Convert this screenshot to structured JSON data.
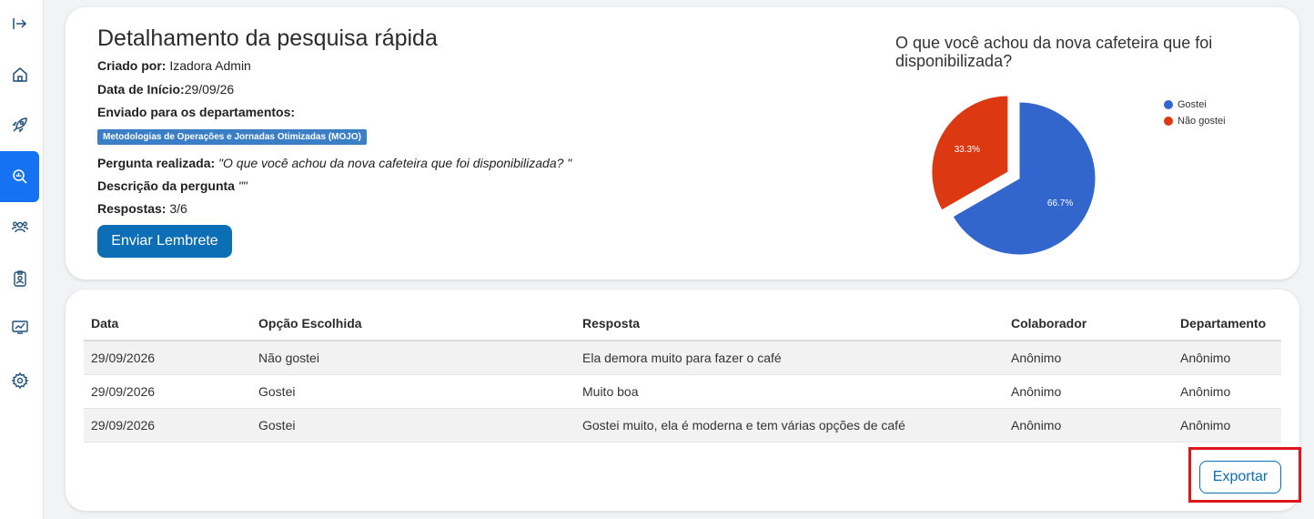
{
  "sidebar": {
    "items": [
      {
        "icon": "collapse-arrow-icon"
      },
      {
        "icon": "home-icon"
      },
      {
        "icon": "rocket-icon"
      },
      {
        "icon": "search-chart-icon"
      },
      {
        "icon": "users-icon"
      },
      {
        "icon": "badge-icon"
      },
      {
        "icon": "chart-growth-icon"
      },
      {
        "icon": "gear-icon"
      }
    ]
  },
  "survey": {
    "title": "Detalhamento da pesquisa rápida",
    "created_by_label": "Criado por:",
    "created_by_value": " Izadora Admin",
    "start_date_label": "Data de Início:",
    "start_date_value": "29/09/26",
    "sent_to_label": "Enviado para os departamentos:",
    "department": "Metodologias de Operações e Jornadas Otimizadas (MOJO)",
    "question_label": "Pergunta realizada:",
    "question_value": " \"O que você achou da nova cafeteira que foi disponibilizada? \"",
    "description_label": "Descrição da pergunta",
    "description_value": " \"\"",
    "responses_label": "Respostas:",
    "responses_value": " 3/6",
    "remind_button": "Enviar Lembrete"
  },
  "chart_data": {
    "type": "pie",
    "title": "O que você achou da nova cafeteira que foi disponibilizada?",
    "categories": [
      "Gostei",
      "Não gostei"
    ],
    "values": [
      66.7,
      33.3
    ],
    "labels": [
      "66.7%",
      "33.3%"
    ],
    "colors": [
      "#3366cc",
      "#dc3912"
    ],
    "legend_position": "right"
  },
  "table": {
    "headers": [
      "Data",
      "Opção Escolhida",
      "Resposta",
      "Colaborador",
      "Departamento"
    ],
    "rows": [
      [
        "29/09/2026",
        "Não gostei",
        "Ela demora muito para fazer o café",
        "Anônimo",
        "Anônimo"
      ],
      [
        "29/09/2026",
        "Gostei",
        "Muito boa",
        "Anônimo",
        "Anônimo"
      ],
      [
        "29/09/2026",
        "Gostei",
        "Gostei muito, ela é moderna e tem várias opções de café",
        "Anônimo",
        "Anônimo"
      ]
    ]
  },
  "export_button": "Exportar"
}
